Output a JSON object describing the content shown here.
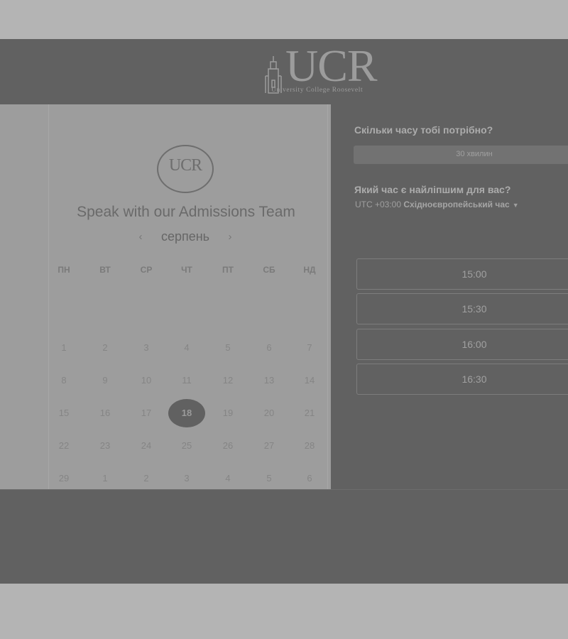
{
  "header": {
    "logo_text": "UCR",
    "logo_subtitle": "University College Roosevelt"
  },
  "calendar": {
    "emblem_text": "UCR",
    "title": "Speak with our Admissions Team",
    "month": "серпень",
    "prev_glyph": "‹",
    "next_glyph": "›",
    "weekdays": [
      "ПН",
      "ВТ",
      "СР",
      "ЧТ",
      "ПТ",
      "СБ",
      "НД"
    ],
    "weeks": [
      [
        "1",
        "2",
        "3",
        "4",
        "5",
        "6",
        "7"
      ],
      [
        "8",
        "9",
        "10",
        "11",
        "12",
        "13",
        "14"
      ],
      [
        "15",
        "16",
        "17",
        "18",
        "19",
        "20",
        "21"
      ],
      [
        "22",
        "23",
        "24",
        "25",
        "26",
        "27",
        "28"
      ],
      [
        "29",
        "1",
        "2",
        "3",
        "4",
        "5",
        "6"
      ]
    ],
    "selected_day": "18"
  },
  "booking": {
    "duration_question": "Скільки часу тобі потрібно?",
    "duration_value": "30 хвилин",
    "time_question": "Який час є найліпшим для вас?",
    "timezone_offset": "UTC +03:00",
    "timezone_name": "Східноєвропейський час",
    "timezone_caret": "▼",
    "slots": [
      "15:00",
      "15:30",
      "16:00",
      "16:30"
    ]
  }
}
